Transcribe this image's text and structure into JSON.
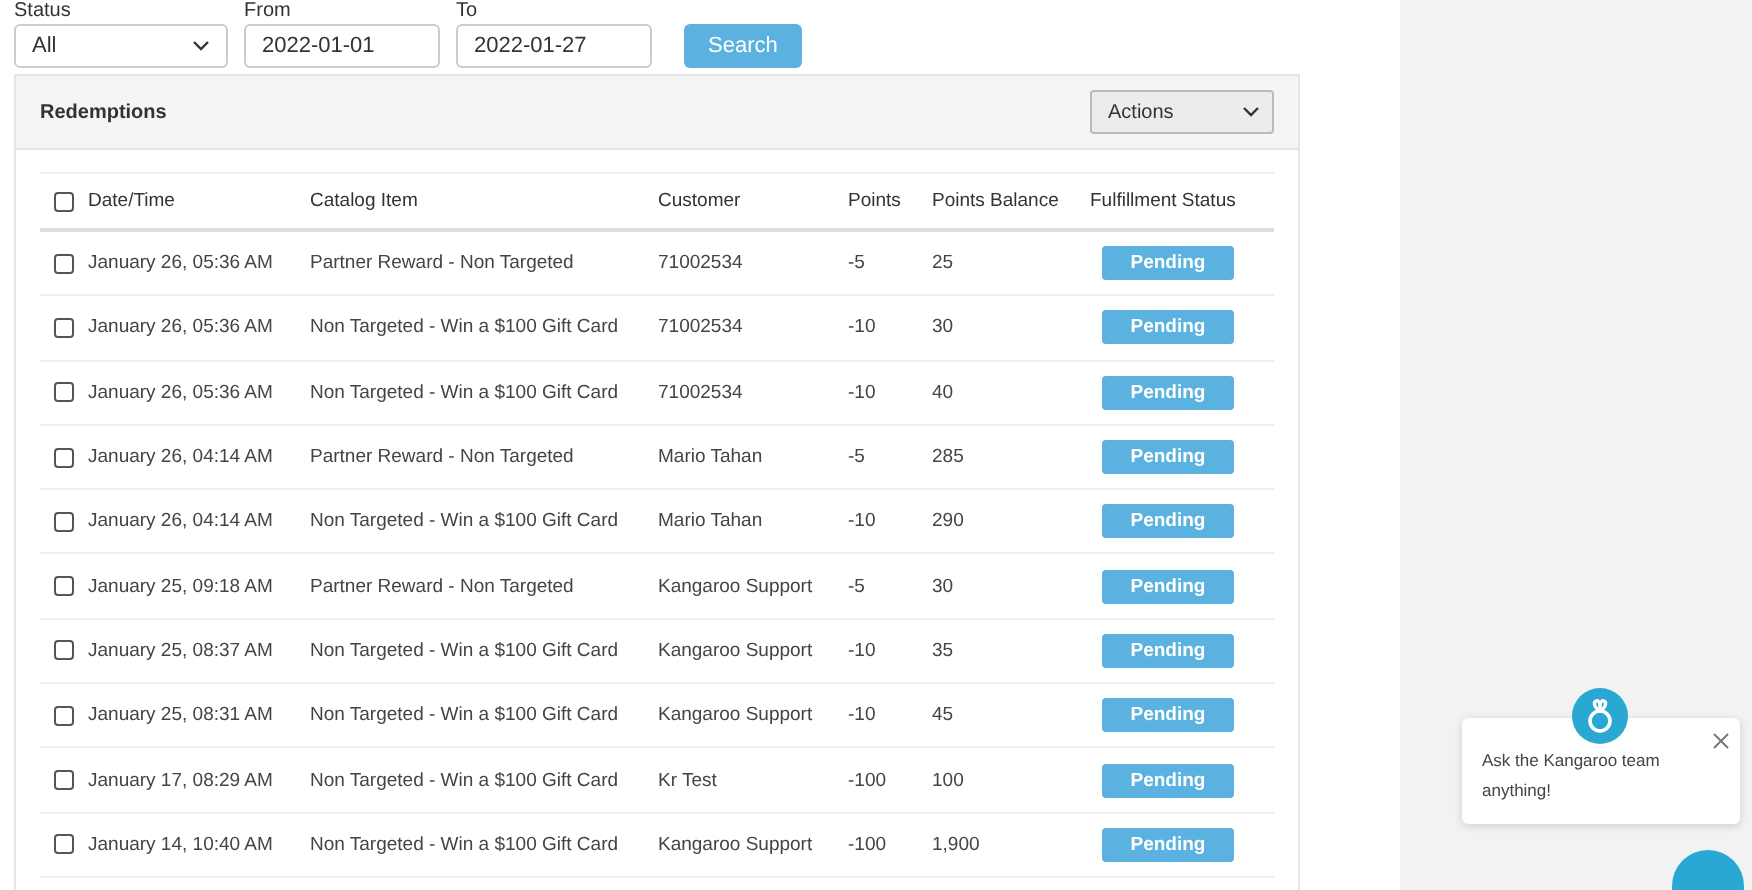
{
  "filters": {
    "status": {
      "label": "Status",
      "value": "All"
    },
    "from": {
      "label": "From",
      "value": "2022-01-01"
    },
    "to": {
      "label": "To",
      "value": "2022-01-27"
    },
    "search_button": "Search"
  },
  "panel": {
    "title": "Redemptions",
    "actions": "Actions"
  },
  "table": {
    "select_all": false,
    "columns": [
      "Date/Time",
      "Catalog Item",
      "Customer",
      "Points",
      "Points Balance",
      "Fulfillment Status"
    ],
    "rows": [
      {
        "checked": false,
        "cells": [
          "January 26, 05:36 AM",
          "Partner Reward - Non Targeted",
          "71002534",
          "-5",
          "25"
        ],
        "status": "Pending"
      },
      {
        "checked": false,
        "cells": [
          "January 26, 05:36 AM",
          "Non Targeted - Win a $100 Gift Card",
          "71002534",
          "-10",
          "30"
        ],
        "status": "Pending"
      },
      {
        "checked": false,
        "cells": [
          "January 26, 05:36 AM",
          "Non Targeted - Win a $100 Gift Card",
          "71002534",
          "-10",
          "40"
        ],
        "status": "Pending"
      },
      {
        "checked": false,
        "cells": [
          "January 26, 04:14 AM",
          "Partner Reward - Non Targeted",
          "Mario Tahan",
          "-5",
          "285"
        ],
        "status": "Pending"
      },
      {
        "checked": false,
        "cells": [
          "January 26, 04:14 AM",
          "Non Targeted - Win a $100 Gift Card",
          "Mario Tahan",
          "-10",
          "290"
        ],
        "status": "Pending"
      },
      {
        "checked": false,
        "cells": [
          "January 25, 09:18 AM",
          "Partner Reward - Non Targeted",
          "Kangaroo Support",
          "-5",
          "30"
        ],
        "status": "Pending"
      },
      {
        "checked": false,
        "cells": [
          "January 25, 08:37 AM",
          "Non Targeted - Win a $100 Gift Card",
          "Kangaroo Support",
          "-10",
          "35"
        ],
        "status": "Pending"
      },
      {
        "checked": false,
        "cells": [
          "January 25, 08:31 AM",
          "Non Targeted - Win a $100 Gift Card",
          "Kangaroo Support",
          "-10",
          "45"
        ],
        "status": "Pending"
      },
      {
        "checked": false,
        "cells": [
          "January 17, 08:29 AM",
          "Non Targeted - Win a $100 Gift Card",
          "Kr Test",
          "-100",
          "100"
        ],
        "status": "Pending"
      },
      {
        "checked": false,
        "cells": [
          "January 14, 10:40 AM",
          "Non Targeted - Win a $100 Gift Card",
          "Kangaroo Support",
          "-100",
          "1,900"
        ],
        "status": "Pending"
      }
    ]
  },
  "chat": {
    "message": "Ask the Kangaroo team anything!"
  }
}
